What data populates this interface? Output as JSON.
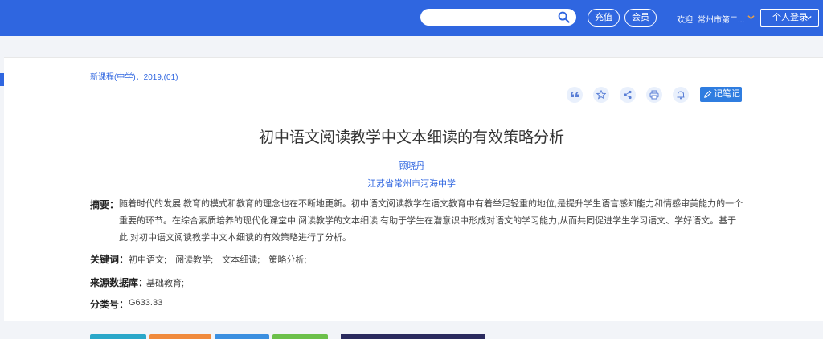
{
  "header": {
    "search_placeholder": "",
    "recharge_label": "充值",
    "member_label": "会员",
    "welcome_label": "欢迎",
    "org_name": "常州市第二...",
    "login_label": "个人登录"
  },
  "article": {
    "source": "新课程(中学)．2019,(01)",
    "note_label": "记笔记",
    "title": "初中语文阅读教学中文本细读的有效策略分析",
    "author": "顾晓丹",
    "affiliation": "江苏省常州市河海中学",
    "abstract_label": "摘要：",
    "abstract_lines": [
      "随着时代的发展,教育的模式和教育的理念也在不断地更新。初中语文阅读教学在语文教育中有着举足轻重的地位,是提升学生语言感知能力和情感审美能力的一个",
      "重要的环节。在综合素质培养的现代化课堂中,阅读教学的文本细读,有助于学生在潜意识中形成对语文的学习能力,从而共同促进学生学习语文、学好语文。基于",
      "此,对初中语文阅读教学中文本细读的有效策略进行了分析。"
    ],
    "keywords_label": "关键词：",
    "keywords": [
      "初中语文;",
      "阅读教学;",
      "文本细读;",
      "策略分析;"
    ],
    "database_label": "来源数据库：",
    "database_value": "基础教育;",
    "class_label": "分类号：",
    "class_value": "G633.33"
  },
  "colors": {
    "brand": "#2f66e0",
    "bottom_buttons": [
      "#2aa7c9",
      "#f08a3c",
      "#3b8fe0",
      "#6cc04a"
    ]
  }
}
